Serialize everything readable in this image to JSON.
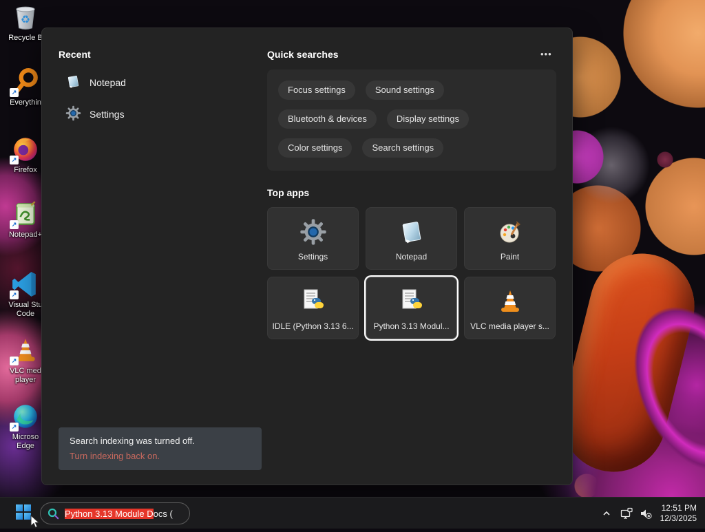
{
  "desktop_icons": [
    {
      "label": "Recycle B"
    },
    {
      "label": "Everythin"
    },
    {
      "label": "Firefox"
    },
    {
      "label": "Notepad+"
    },
    {
      "label": "Visual Stu",
      "label2": "Code"
    },
    {
      "label": "VLC med",
      "label2": "player"
    },
    {
      "label": "Microso",
      "label2": "Edge"
    }
  ],
  "panel": {
    "recent": {
      "header": "Recent",
      "items": [
        {
          "label": "Notepad"
        },
        {
          "label": "Settings"
        }
      ]
    },
    "quick_searches": {
      "header": "Quick searches",
      "more_label": "•••",
      "pills": [
        "Focus settings",
        "Sound settings",
        "Bluetooth & devices",
        "Display settings",
        "Color settings",
        "Search settings"
      ]
    },
    "top_apps": {
      "header": "Top apps",
      "tiles": [
        {
          "label": "Settings"
        },
        {
          "label": "Notepad"
        },
        {
          "label": "Paint"
        },
        {
          "label": "IDLE (Python 3.13 6..."
        },
        {
          "label": "Python 3.13 Modul...",
          "selected": true
        },
        {
          "label": "VLC media player s..."
        }
      ]
    },
    "notification": {
      "message": "Search indexing was turned off.",
      "action": "Turn indexing back on."
    }
  },
  "taskbar": {
    "search": {
      "highlighted_text": "Python 3.13 Module D",
      "rest_text": "ocs ("
    },
    "clock": {
      "time": "12:51 PM",
      "date": "12/3/2025"
    }
  },
  "colors": {
    "selection_red": "#e5362a",
    "notification_link": "#c9695e",
    "start_blue": "#2e9be6",
    "panel_bg": "#232323"
  }
}
